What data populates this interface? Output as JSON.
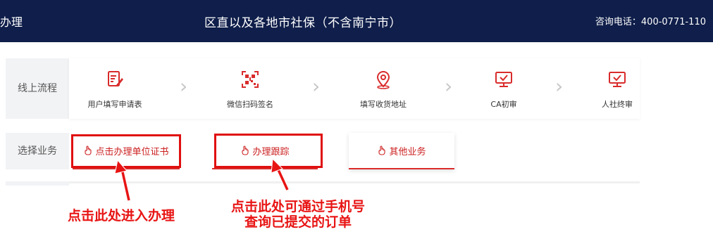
{
  "header": {
    "left_title": "办理",
    "center_title": "区直以及各地市社保（不含南宁市）",
    "hotline": "咨询电话：400-0771-110"
  },
  "online_process": {
    "label": "线上流程",
    "steps": [
      {
        "label": "用户填写申请表",
        "icon": "form-edit-icon"
      },
      {
        "label": "微信扫码签名",
        "icon": "qr-code-icon"
      },
      {
        "label": "填写收货地址",
        "icon": "location-pin-icon"
      },
      {
        "label": "CA初审",
        "icon": "monitor-check-icon"
      },
      {
        "label": "人社终审",
        "icon": "monitor-check-icon"
      }
    ]
  },
  "business": {
    "label": "选择业务",
    "tabs": [
      {
        "label": "点击办理单位证书",
        "icon": "hand-pointer-icon"
      },
      {
        "label": "办理跟踪",
        "icon": "hand-pointer-icon"
      },
      {
        "label": "其他业务",
        "icon": "hand-pointer-icon"
      }
    ]
  },
  "annotations": {
    "note1": "点击此处进入办理",
    "note2_line1": "点击此处可通过手机号",
    "note2_line2": "查询已提交的订单"
  },
  "colors": {
    "header_bg": "#0f1e4a",
    "accent_red": "#d92b2b",
    "annotation_red": "#e81414"
  }
}
